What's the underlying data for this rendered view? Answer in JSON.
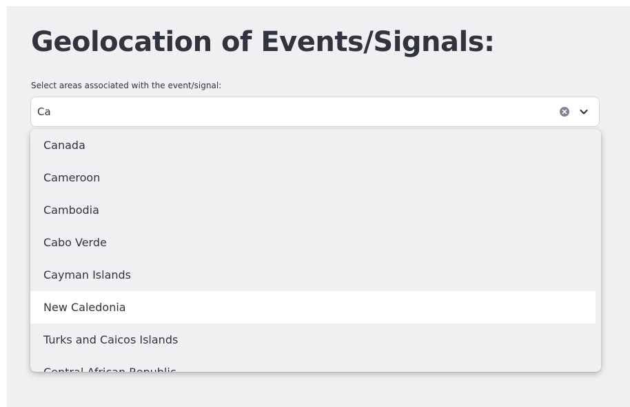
{
  "page": {
    "title": "Geolocation of Events/Signals:"
  },
  "area_select": {
    "label": "Select areas associated with the event/signal:",
    "query": "Ca",
    "options": [
      "Canada",
      "Cameroon",
      "Cambodia",
      "Cabo Verde",
      "Cayman Islands",
      "New Caledonia",
      "Turks and Caicos Islands",
      "Central African Republic"
    ],
    "highlighted_option": "New Caledonia"
  },
  "icons": {
    "clear": "clear-circle-icon",
    "expand": "chevron-down-icon"
  },
  "colors": {
    "app_background": "#f0f0f2",
    "text": "#31333f",
    "icon": "#31333f",
    "highlight": "#ffffff"
  }
}
